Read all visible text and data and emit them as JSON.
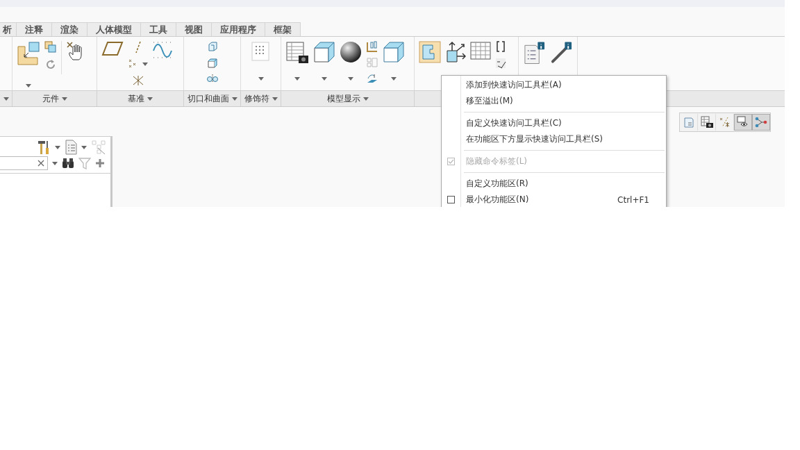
{
  "tabs": [
    {
      "label": "析",
      "selected": false
    },
    {
      "label": "注释",
      "selected": false
    },
    {
      "label": "渲染",
      "selected": false
    },
    {
      "label": "人体模型",
      "selected": false
    },
    {
      "label": "工具",
      "selected": false
    },
    {
      "label": "视图",
      "selected": false
    },
    {
      "label": "应用程序",
      "selected": false
    },
    {
      "label": "框架",
      "selected": false
    }
  ],
  "ribbon_groups": [
    {
      "label": "元件"
    },
    {
      "label": "基准"
    },
    {
      "label": "切口和曲面"
    },
    {
      "label": "修饰符"
    },
    {
      "label": "模型显示"
    }
  ],
  "context_menu": [
    {
      "kind": "item",
      "label": "添加到快速访问工具栏(A)",
      "disabled": false
    },
    {
      "kind": "item",
      "label": "移至溢出(M)",
      "disabled": false
    },
    {
      "kind": "separator"
    },
    {
      "kind": "item",
      "label": "自定义快速访问工具栏(C)",
      "disabled": false
    },
    {
      "kind": "item",
      "label": "在功能区下方显示快速访问工具栏(S)",
      "disabled": false
    },
    {
      "kind": "separator"
    },
    {
      "kind": "check",
      "label": "隐藏命令标签(L)",
      "checked": true,
      "disabled": true
    },
    {
      "kind": "separator"
    },
    {
      "kind": "item",
      "label": "自定义功能区(R)",
      "disabled": false
    },
    {
      "kind": "check",
      "label": "最小化功能区(N)",
      "checked": false,
      "disabled": false,
      "shortcut": "Ctrl+F1"
    }
  ]
}
